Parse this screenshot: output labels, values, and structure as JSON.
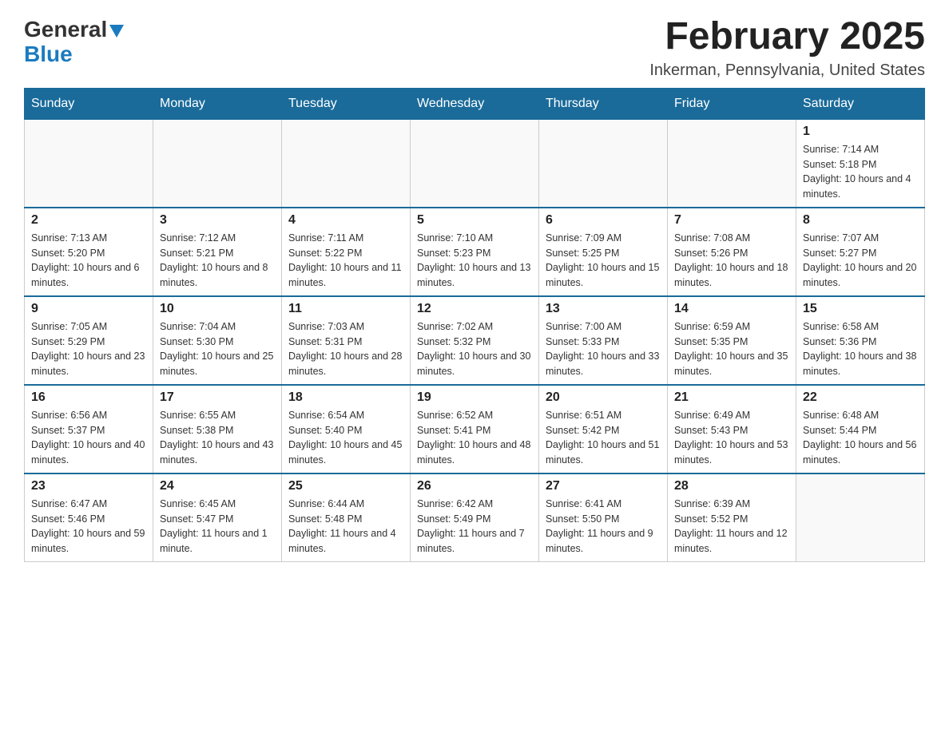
{
  "logo": {
    "general": "General",
    "blue": "Blue"
  },
  "title": "February 2025",
  "location": "Inkerman, Pennsylvania, United States",
  "weekdays": [
    "Sunday",
    "Monday",
    "Tuesday",
    "Wednesday",
    "Thursday",
    "Friday",
    "Saturday"
  ],
  "weeks": [
    [
      {
        "day": "",
        "info": ""
      },
      {
        "day": "",
        "info": ""
      },
      {
        "day": "",
        "info": ""
      },
      {
        "day": "",
        "info": ""
      },
      {
        "day": "",
        "info": ""
      },
      {
        "day": "",
        "info": ""
      },
      {
        "day": "1",
        "info": "Sunrise: 7:14 AM\nSunset: 5:18 PM\nDaylight: 10 hours and 4 minutes."
      }
    ],
    [
      {
        "day": "2",
        "info": "Sunrise: 7:13 AM\nSunset: 5:20 PM\nDaylight: 10 hours and 6 minutes."
      },
      {
        "day": "3",
        "info": "Sunrise: 7:12 AM\nSunset: 5:21 PM\nDaylight: 10 hours and 8 minutes."
      },
      {
        "day": "4",
        "info": "Sunrise: 7:11 AM\nSunset: 5:22 PM\nDaylight: 10 hours and 11 minutes."
      },
      {
        "day": "5",
        "info": "Sunrise: 7:10 AM\nSunset: 5:23 PM\nDaylight: 10 hours and 13 minutes."
      },
      {
        "day": "6",
        "info": "Sunrise: 7:09 AM\nSunset: 5:25 PM\nDaylight: 10 hours and 15 minutes."
      },
      {
        "day": "7",
        "info": "Sunrise: 7:08 AM\nSunset: 5:26 PM\nDaylight: 10 hours and 18 minutes."
      },
      {
        "day": "8",
        "info": "Sunrise: 7:07 AM\nSunset: 5:27 PM\nDaylight: 10 hours and 20 minutes."
      }
    ],
    [
      {
        "day": "9",
        "info": "Sunrise: 7:05 AM\nSunset: 5:29 PM\nDaylight: 10 hours and 23 minutes."
      },
      {
        "day": "10",
        "info": "Sunrise: 7:04 AM\nSunset: 5:30 PM\nDaylight: 10 hours and 25 minutes."
      },
      {
        "day": "11",
        "info": "Sunrise: 7:03 AM\nSunset: 5:31 PM\nDaylight: 10 hours and 28 minutes."
      },
      {
        "day": "12",
        "info": "Sunrise: 7:02 AM\nSunset: 5:32 PM\nDaylight: 10 hours and 30 minutes."
      },
      {
        "day": "13",
        "info": "Sunrise: 7:00 AM\nSunset: 5:33 PM\nDaylight: 10 hours and 33 minutes."
      },
      {
        "day": "14",
        "info": "Sunrise: 6:59 AM\nSunset: 5:35 PM\nDaylight: 10 hours and 35 minutes."
      },
      {
        "day": "15",
        "info": "Sunrise: 6:58 AM\nSunset: 5:36 PM\nDaylight: 10 hours and 38 minutes."
      }
    ],
    [
      {
        "day": "16",
        "info": "Sunrise: 6:56 AM\nSunset: 5:37 PM\nDaylight: 10 hours and 40 minutes."
      },
      {
        "day": "17",
        "info": "Sunrise: 6:55 AM\nSunset: 5:38 PM\nDaylight: 10 hours and 43 minutes."
      },
      {
        "day": "18",
        "info": "Sunrise: 6:54 AM\nSunset: 5:40 PM\nDaylight: 10 hours and 45 minutes."
      },
      {
        "day": "19",
        "info": "Sunrise: 6:52 AM\nSunset: 5:41 PM\nDaylight: 10 hours and 48 minutes."
      },
      {
        "day": "20",
        "info": "Sunrise: 6:51 AM\nSunset: 5:42 PM\nDaylight: 10 hours and 51 minutes."
      },
      {
        "day": "21",
        "info": "Sunrise: 6:49 AM\nSunset: 5:43 PM\nDaylight: 10 hours and 53 minutes."
      },
      {
        "day": "22",
        "info": "Sunrise: 6:48 AM\nSunset: 5:44 PM\nDaylight: 10 hours and 56 minutes."
      }
    ],
    [
      {
        "day": "23",
        "info": "Sunrise: 6:47 AM\nSunset: 5:46 PM\nDaylight: 10 hours and 59 minutes."
      },
      {
        "day": "24",
        "info": "Sunrise: 6:45 AM\nSunset: 5:47 PM\nDaylight: 11 hours and 1 minute."
      },
      {
        "day": "25",
        "info": "Sunrise: 6:44 AM\nSunset: 5:48 PM\nDaylight: 11 hours and 4 minutes."
      },
      {
        "day": "26",
        "info": "Sunrise: 6:42 AM\nSunset: 5:49 PM\nDaylight: 11 hours and 7 minutes."
      },
      {
        "day": "27",
        "info": "Sunrise: 6:41 AM\nSunset: 5:50 PM\nDaylight: 11 hours and 9 minutes."
      },
      {
        "day": "28",
        "info": "Sunrise: 6:39 AM\nSunset: 5:52 PM\nDaylight: 11 hours and 12 minutes."
      },
      {
        "day": "",
        "info": ""
      }
    ]
  ]
}
